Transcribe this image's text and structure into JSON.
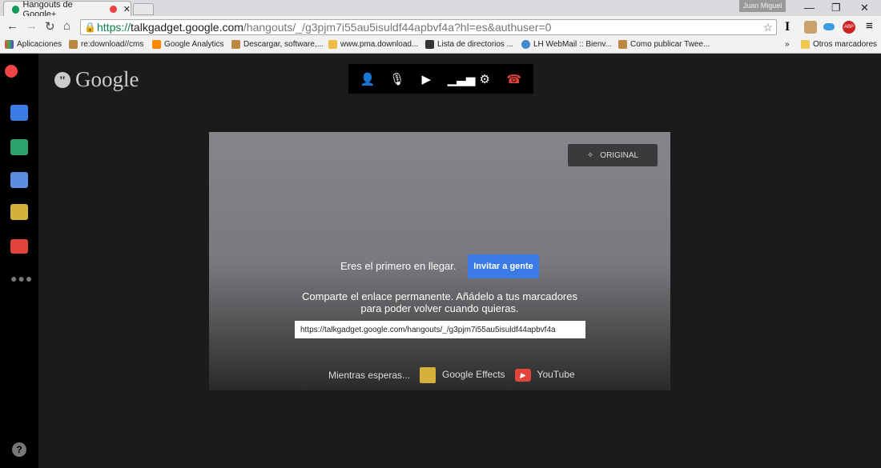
{
  "browser": {
    "tab_title": "Hangouts de Google+",
    "user": "Juan Miguel",
    "url_secure": "https://",
    "url_host": "talkgadget.google.com",
    "url_path": "/hangouts/_/g3pjm7i55au5isuldf44apbvf4a?hl=es&authuser=0",
    "bookmarks": [
      "Aplicaciones",
      "re:download//cms",
      "Google Analytics",
      "Descargar, software,...",
      "www.pma.download...",
      "Lista de directorios ...",
      "LH WebMail :: Bienv...",
      "Como publicar Twee..."
    ],
    "more_bookmarks": "»",
    "other_bookmarks": "Otros marcadores"
  },
  "sidebar": {
    "items": [
      "hangouts-app",
      "chat",
      "screenshare",
      "camera",
      "google-effects",
      "youtube",
      "more"
    ]
  },
  "logo": "Google",
  "toolbar": {
    "icons": [
      "add-person-icon",
      "mic-off-icon",
      "camera-off-icon",
      "bandwidth-icon",
      "settings-icon",
      "hang-up-icon"
    ]
  },
  "video": {
    "original_label": "ORIGINAL",
    "first_text": "Eres el primero en llegar.",
    "invite_label": "Invitar a gente",
    "share_line1": "Comparte el enlace permanente. Añádelo a tus marcadores",
    "share_line2": "para poder volver cuando quieras.",
    "link_value": "https://talkgadget.google.com/hangouts/_/g3pjm7i55au5isuldf44apbvf4a",
    "waiting": "Mientras esperas...",
    "apps": [
      "Google Effects",
      "YouTube"
    ]
  },
  "colors": {
    "accent": "#3b7be6",
    "hangup": "#e0443a"
  }
}
